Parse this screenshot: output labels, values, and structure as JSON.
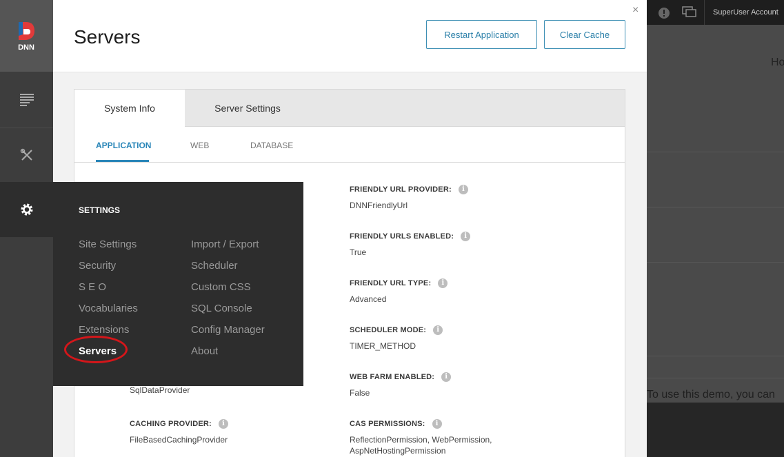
{
  "logo": {
    "text": "DNN"
  },
  "header": {
    "title": "Servers",
    "restart_label": "Restart Application",
    "clear_cache_label": "Clear Cache",
    "close_glyph": "×"
  },
  "tabs": [
    {
      "label": "System Info"
    },
    {
      "label": "Server Settings"
    }
  ],
  "subtabs": [
    {
      "label": "APPLICATION"
    },
    {
      "label": "WEB"
    },
    {
      "label": "DATABASE"
    }
  ],
  "fields_left": [
    {
      "label": "",
      "value": "SqlDataProvider"
    },
    {
      "label": "CACHING PROVIDER:",
      "value": "FileBasedCachingProvider"
    }
  ],
  "fields_right": [
    {
      "label": "FRIENDLY URL PROVIDER:",
      "value": "DNNFriendlyUrl"
    },
    {
      "label": "FRIENDLY URLS ENABLED:",
      "value": "True"
    },
    {
      "label": "FRIENDLY URL TYPE:",
      "value": "Advanced"
    },
    {
      "label": "SCHEDULER MODE:",
      "value": "TIMER_METHOD"
    },
    {
      "label": "WEB FARM ENABLED:",
      "value": "False"
    },
    {
      "label": "CAS PERMISSIONS:",
      "value": "ReflectionPermission, WebPermission, AspNetHostingPermission"
    }
  ],
  "info_glyph": "i",
  "flyout": {
    "title": "SETTINGS",
    "col1": [
      "Site Settings",
      "Security",
      "S E O",
      "Vocabularies",
      "Extensions",
      "Servers"
    ],
    "col2": [
      "Import / Export",
      "Scheduler",
      "Custom CSS",
      "SQL Console",
      "Config Manager",
      "About"
    ]
  },
  "background_page": {
    "account": "SuperUser Account",
    "heading_fragment": "Ho",
    "demo_text": "To use this demo, you can"
  },
  "colors": {
    "accent": "#2a86b8",
    "highlight_circle": "#d4161a",
    "sidebar": "#3d3d3d",
    "flyout": "#2d2d2d"
  }
}
